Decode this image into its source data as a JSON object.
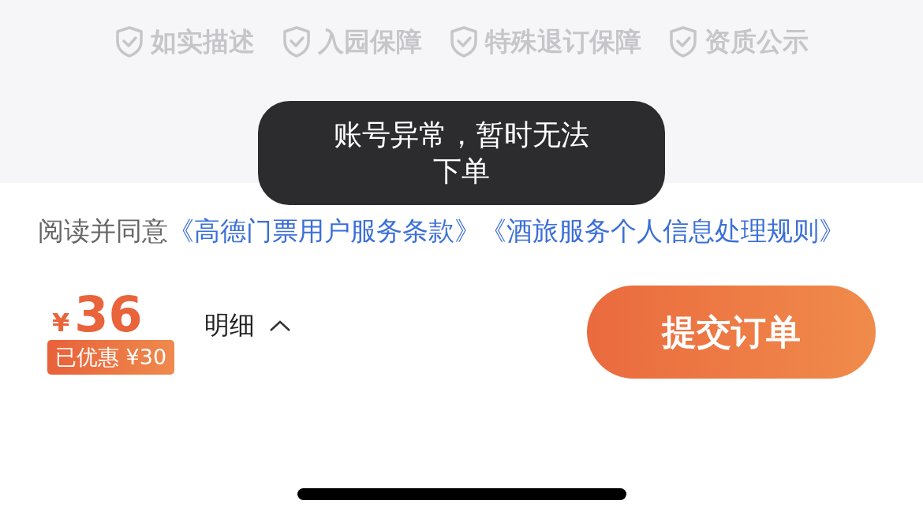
{
  "guarantees": [
    {
      "label": "如实描述"
    },
    {
      "label": "入园保障"
    },
    {
      "label": "特殊退订保障"
    },
    {
      "label": "资质公示"
    }
  ],
  "toast": {
    "text": "账号异常，暂时无法下单"
  },
  "agreement": {
    "prefix": "阅读并同意",
    "links": [
      "《高德门票用户服务条款》",
      "《酒旅服务个人信息处理规则》"
    ]
  },
  "price": {
    "currency": "¥",
    "amount": "36",
    "discount": "已优惠 ¥30"
  },
  "details": {
    "label": "明细"
  },
  "submit": {
    "label": "提交订单"
  }
}
